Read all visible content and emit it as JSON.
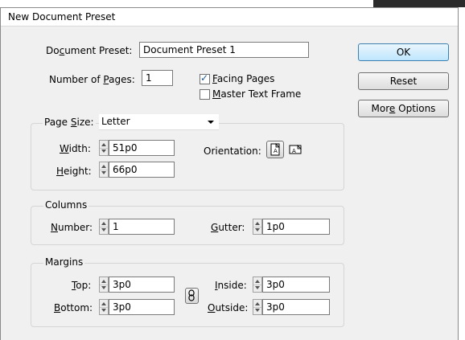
{
  "window": {
    "title": "New Document Preset"
  },
  "document_preset": {
    "label": "Document Preset:",
    "value": "Document Preset 1"
  },
  "pages": {
    "label": "Number of Pages:",
    "value": "1",
    "facing_pages": {
      "label": "Facing Pages",
      "checked": true
    },
    "master_text_frame": {
      "label": "Master Text Frame",
      "checked": false
    }
  },
  "page_size": {
    "label": "Page Size:",
    "selected": "Letter",
    "width": {
      "label": "Width:",
      "value": "51p0"
    },
    "height": {
      "label": "Height:",
      "value": "66p0"
    },
    "orientation": {
      "label": "Orientation:",
      "selected": "portrait"
    }
  },
  "columns": {
    "title": "Columns",
    "number": {
      "label": "Number:",
      "value": "1"
    },
    "gutter": {
      "label": "Gutter:",
      "value": "1p0"
    }
  },
  "margins": {
    "title": "Margins",
    "top": {
      "label": "Top:",
      "value": "3p0"
    },
    "bottom": {
      "label": "Bottom:",
      "value": "3p0"
    },
    "inside": {
      "label": "Inside:",
      "value": "3p0"
    },
    "outside": {
      "label": "Outside:",
      "value": "3p0"
    }
  },
  "buttons": {
    "ok": "OK",
    "reset": "Reset",
    "more_options": "More Options"
  }
}
